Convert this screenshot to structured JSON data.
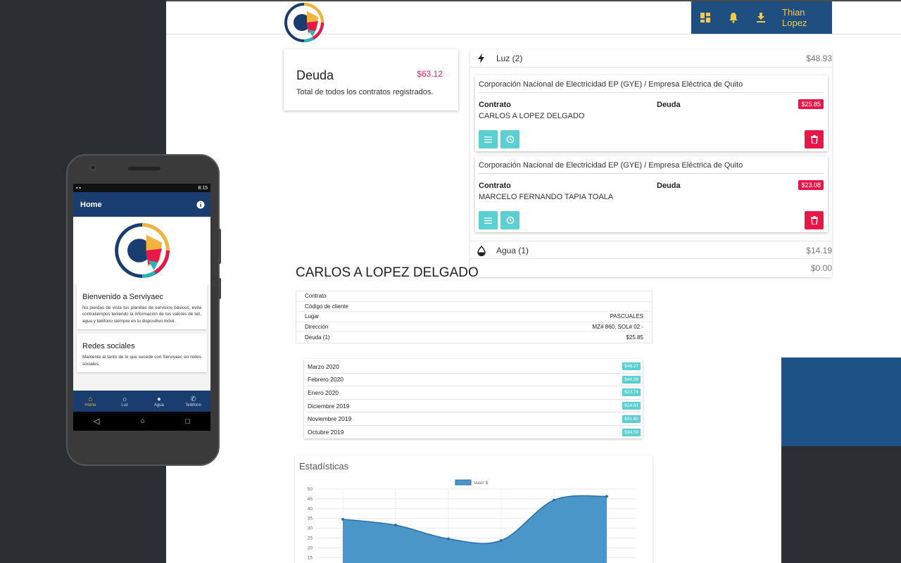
{
  "header": {
    "user_name": "Thian Lopez",
    "icons": [
      "dashboard-icon",
      "bell-icon",
      "download-icon"
    ]
  },
  "summary": {
    "title": "Deuda",
    "amount": "$63.12",
    "subtitle": "Total de todos los contratos registrados."
  },
  "services": {
    "luz": {
      "label": "Luz (2)",
      "amount": "$48.93"
    },
    "agua": {
      "label": "Agua (1)",
      "amount": "$14.19"
    },
    "other_amount": "$0.00"
  },
  "contracts": [
    {
      "provider": "Corporación Nacional de Electricidad EP (GYE) / Empresa Eléctrica de Quito",
      "contract_label": "Contrato",
      "debt_label": "Deuda",
      "holder": "CARLOS A LOPEZ DELGADO",
      "amount": "$25.85"
    },
    {
      "provider": "Corporación Nacional de Electricidad EP (GYE) / Empresa Eléctrica de Quito",
      "contract_label": "Contrato",
      "debt_label": "Deuda",
      "holder": "MARCELO FERNANDO TAPIA TOALA",
      "amount": "$23.08"
    }
  ],
  "detail": {
    "name": "CARLOS A LOPEZ DELGADO",
    "rows": [
      {
        "label": "Contrato",
        "value": ""
      },
      {
        "label": "Código de cliente",
        "value": ""
      },
      {
        "label": "Lugar",
        "value": "PASCUALES"
      },
      {
        "label": "Dirección",
        "value": "MZ# 860, SOL# 02 -"
      },
      {
        "label": "Deuda (1)",
        "value": "$25.85"
      }
    ],
    "months": [
      {
        "label": "Marzo 2020",
        "value": "$46.27"
      },
      {
        "label": "Febrero 2020",
        "value": "$44.39"
      },
      {
        "label": "Enero 2020",
        "value": "$23.74"
      },
      {
        "label": "Diciembre 2019",
        "value": "$24.61"
      },
      {
        "label": "Noviembre 2019",
        "value": "$31.60"
      },
      {
        "label": "Octubre 2019",
        "value": "$34.59"
      }
    ]
  },
  "stats": {
    "title": "Estadísticas"
  },
  "chart_data": {
    "type": "area",
    "series": [
      {
        "name": "Valor $",
        "values": [
          34.59,
          31.6,
          24.61,
          23.74,
          44.39,
          46.27
        ]
      }
    ],
    "yticks": [
      50,
      45,
      40,
      35,
      30,
      25,
      20,
      15
    ],
    "ylim": [
      0,
      50
    ],
    "legend": "top",
    "grid": true,
    "color": "#4a96c8"
  },
  "phone": {
    "status_time": "8:15",
    "app_title": "Home",
    "welcome_title": "Bienvenido a Serviyaec",
    "welcome_text": "No pierdas de vista tus planillas de servicios básicos, evita contratiempos teniendo la información de tus valores de luz, agua y teléfono siempre en tu dispositivo móvil.",
    "social_title": "Redes sociales",
    "social_text": "Mantente al tanto de lo que sucede con Serviyaec en redes sociales.",
    "nav": [
      "Home",
      "Luz",
      "Agua",
      "Teléfono"
    ]
  },
  "colors": {
    "brand_blue": "#1f4f80",
    "accent_yellow": "#f2c94c",
    "danger": "#e8174a",
    "teal": "#5bd0d3"
  }
}
